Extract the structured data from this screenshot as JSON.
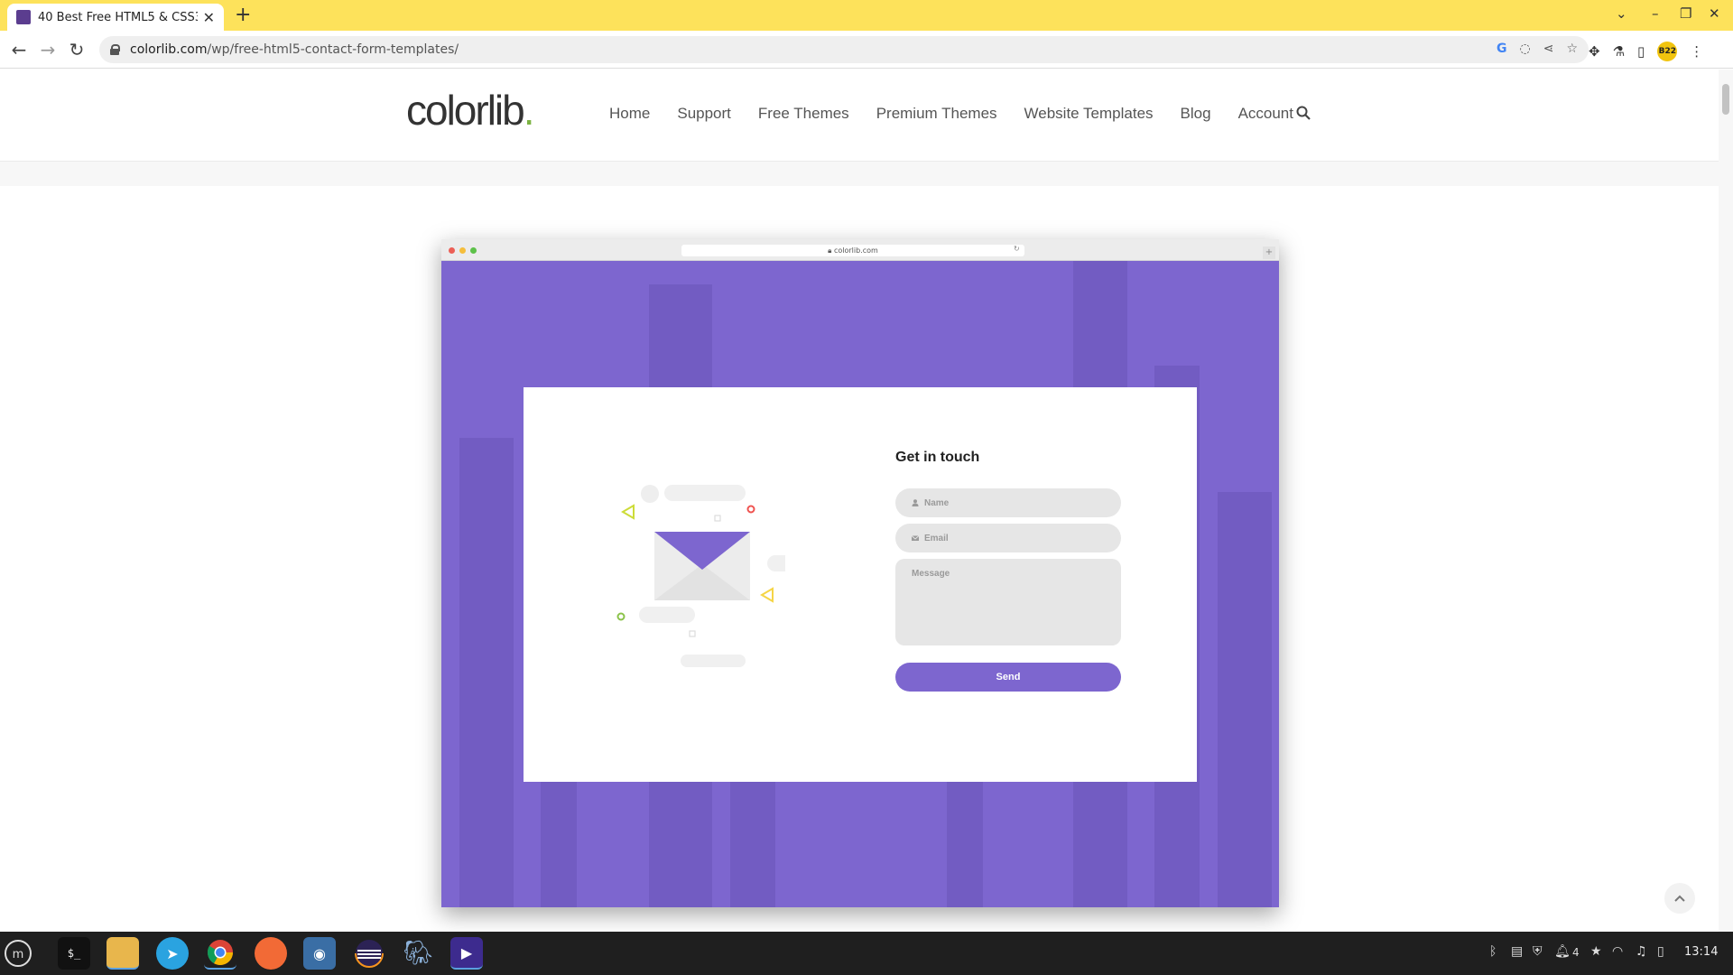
{
  "browser": {
    "tab_title": "40 Best Free HTML5 & CSS3 C",
    "url_domain": "colorlib.com",
    "url_path": "/wp/free-html5-contact-form-templates/",
    "profile_label": "B22"
  },
  "site": {
    "logo_text": "colorlib",
    "logo_dot": ".",
    "nav": [
      "Home",
      "Support",
      "Free Themes",
      "Premium Themes",
      "Website Templates",
      "Blog",
      "Account"
    ]
  },
  "mockup": {
    "url": "colorlib.com",
    "form": {
      "title": "Get in touch",
      "name_placeholder": "Name",
      "email_placeholder": "Email",
      "message_placeholder": "Message",
      "send_label": "Send"
    }
  },
  "taskbar": {
    "tray_badge": "4",
    "clock": "13:14"
  },
  "colors": {
    "tabbar": "#fde25b",
    "form_accent": "#7d66cf",
    "logo_dot": "#7cb342"
  }
}
